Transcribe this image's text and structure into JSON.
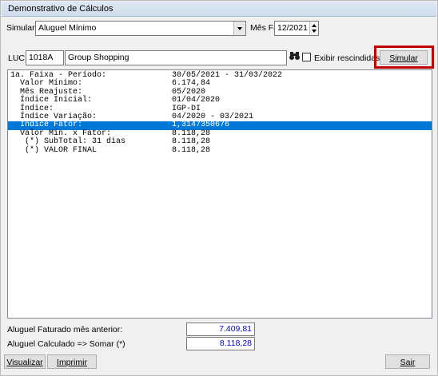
{
  "window": {
    "title": "Demonstrativo de Cálculos"
  },
  "top": {
    "simular_label": "Simular",
    "simular_value": "Aluguel Mínimo",
    "mes_label": "Mês Fat",
    "mes_value": "12/2021"
  },
  "luc": {
    "label": "LUC",
    "code": "1018A",
    "name": "Group Shopping",
    "binoculars_icon": "binoculars-icon",
    "exibir_label": "Exibir rescindidas",
    "simular_button": "Simular"
  },
  "report": [
    {
      "k": "1a. Faixa - Período:",
      "v": "30/05/2021 - 31/03/2022",
      "sel": false
    },
    {
      "k": "  Valor Mínimo:",
      "v": "6.174,84",
      "sel": false
    },
    {
      "k": "  Mês Reajuste:",
      "v": "05/2020",
      "sel": false
    },
    {
      "k": "  Índice Inicial:",
      "v": "01/04/2020",
      "sel": false
    },
    {
      "k": "  Índice:",
      "v": "IGP-DI",
      "sel": false
    },
    {
      "k": "  Índice Variação:",
      "v": "04/2020 - 03/2021",
      "sel": false
    },
    {
      "k": "  Índice Fator:",
      "v": "1,3147350676",
      "sel": true
    },
    {
      "k": "  Valor Min. x Fator:",
      "v": "8.118,28",
      "sel": false
    },
    {
      "k": "   (*) SubTotal: 31 dias",
      "v": "8.118,28",
      "sel": false
    },
    {
      "k": "   (*) VALOR FINAL",
      "v": "8.118,28",
      "sel": false
    }
  ],
  "footer": {
    "faturado_label": "Aluguel Faturado mês anterior:",
    "faturado_value": "7.409,81",
    "calculado_label": "Aluguel Calculado => Somar (*)",
    "calculado_value": "8.118,28",
    "visualizar": "Visualizar",
    "imprimir": "Imprimir",
    "sair": "Sair"
  },
  "colors": {
    "selection": "#0078d7",
    "highlight": "#c00000",
    "value_text": "#0000cc"
  }
}
